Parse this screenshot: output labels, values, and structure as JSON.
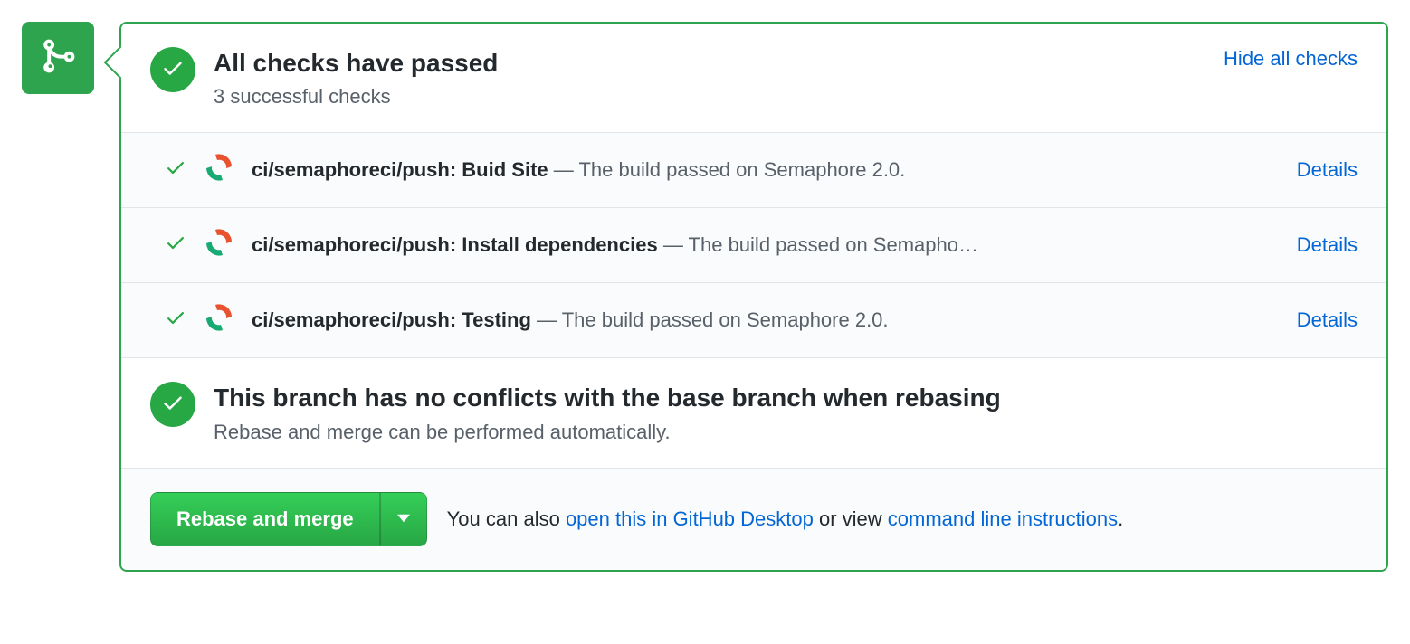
{
  "colors": {
    "success": "#28a745",
    "link": "#0366d6",
    "badge": "#2ea44f"
  },
  "header": {
    "title": "All checks have passed",
    "subtitle": "3 successful checks",
    "hide_link": "Hide all checks"
  },
  "checks": [
    {
      "name": "ci/semaphoreci/push: Buid Site",
      "desc": "The build passed on Semaphore 2.0.",
      "details": "Details"
    },
    {
      "name": "ci/semaphoreci/push: Install dependencies",
      "desc": "The build passed on Semapho…",
      "details": "Details"
    },
    {
      "name": "ci/semaphoreci/push: Testing",
      "desc": "The build passed on Semaphore 2.0.",
      "details": "Details"
    }
  ],
  "conflicts": {
    "title": "This branch has no conflicts with the base branch when rebasing",
    "subtitle": "Rebase and merge can be performed automatically."
  },
  "footer": {
    "button": "Rebase and merge",
    "prefix": "You can also ",
    "link1": "open this in GitHub Desktop",
    "middle": " or view ",
    "link2": "command line instructions",
    "suffix": "."
  }
}
